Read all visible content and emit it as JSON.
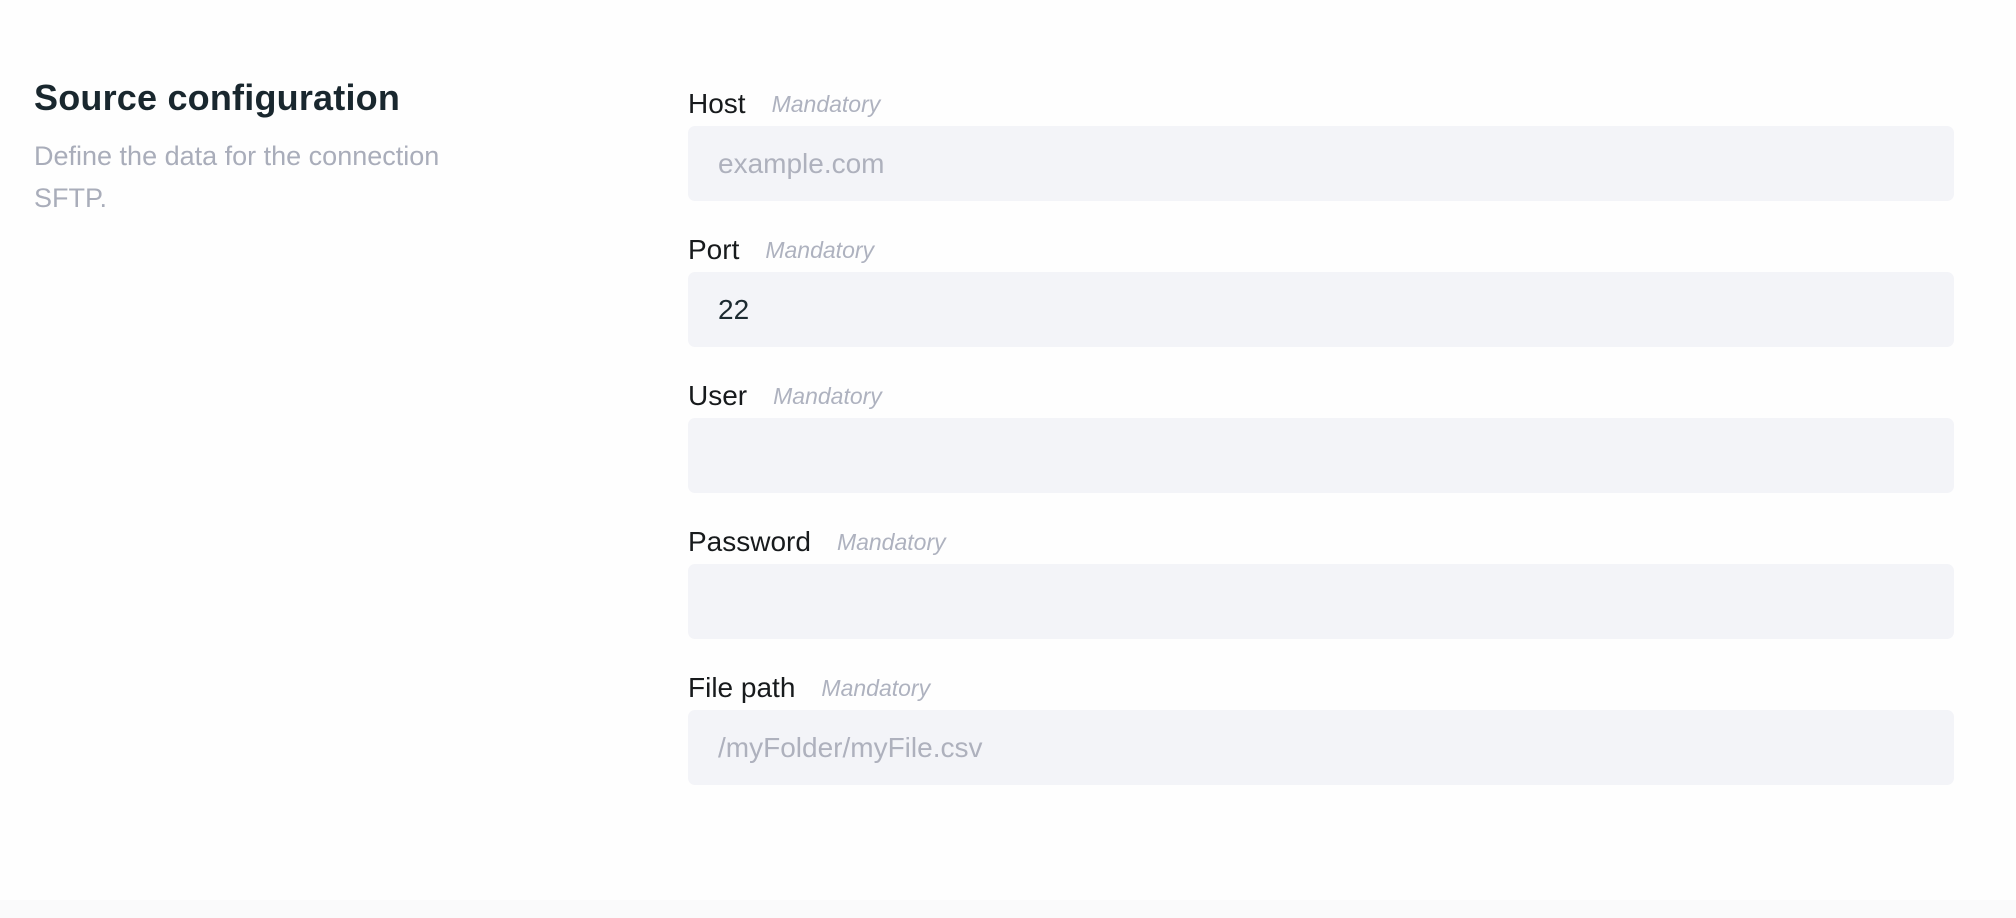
{
  "section": {
    "title": "Source configuration",
    "description": "Define the data for the connection SFTP."
  },
  "fields": [
    {
      "label": "Host",
      "mandatory": "Mandatory",
      "value": "",
      "placeholder": "example.com"
    },
    {
      "label": "Port",
      "mandatory": "Mandatory",
      "value": "22",
      "placeholder": ""
    },
    {
      "label": "User",
      "mandatory": "Mandatory",
      "value": "",
      "placeholder": ""
    },
    {
      "label": "Password",
      "mandatory": "Mandatory",
      "value": "",
      "placeholder": ""
    },
    {
      "label": "File path",
      "mandatory": "Mandatory",
      "value": "",
      "placeholder": "/myFolder/myFile.csv"
    }
  ]
}
